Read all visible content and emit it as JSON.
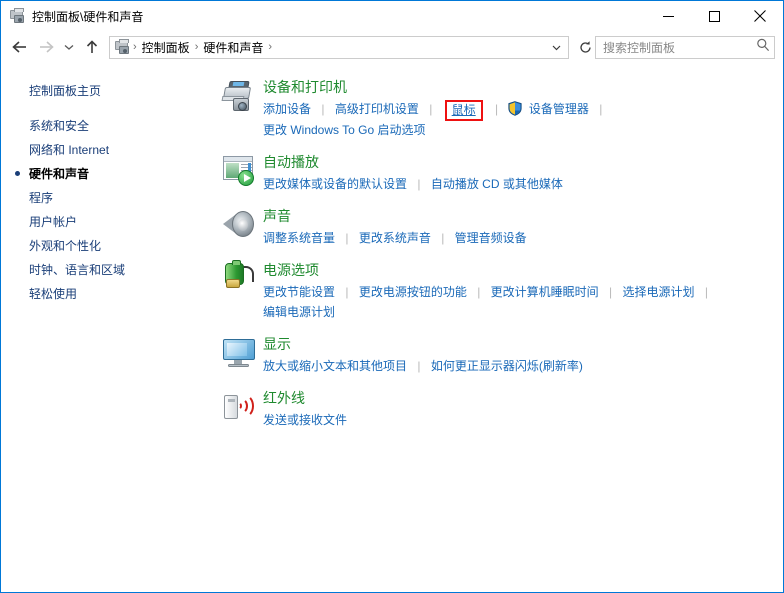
{
  "window": {
    "title": "控制面板\\硬件和声音",
    "icon": "control-panel-devices-icon",
    "minimize_label": "最小化",
    "maximize_label": "最大化",
    "close_label": "关闭"
  },
  "toolbar": {
    "back_label": "后退",
    "forward_label": "前进",
    "recent_label": "最近浏览的位置",
    "up_label": "向上",
    "address": {
      "crumbs": [
        "控制面板",
        "硬件和声音"
      ],
      "separator": "›",
      "dropdown_label": "展开",
      "refresh_label": "刷新"
    },
    "search": {
      "placeholder": "搜索控制面板",
      "icon": "search-icon"
    }
  },
  "sidebar": {
    "items": [
      {
        "label": "控制面板主页",
        "active": false
      },
      {
        "label": "系统和安全",
        "active": false
      },
      {
        "label": "网络和 Internet",
        "active": false
      },
      {
        "label": "硬件和声音",
        "active": true
      },
      {
        "label": "程序",
        "active": false
      },
      {
        "label": "用户帐户",
        "active": false
      },
      {
        "label": "外观和个性化",
        "active": false
      },
      {
        "label": "时钟、语言和区域",
        "active": false
      },
      {
        "label": "轻松使用",
        "active": false
      }
    ]
  },
  "categories": [
    {
      "icon": "printer-icon",
      "title": "设备和打印机",
      "links": [
        "添加设备",
        "高级打印机设置",
        "鼠标",
        "设备管理器",
        "更改 Windows To Go 启动选项"
      ]
    },
    {
      "icon": "autoplay-icon",
      "title": "自动播放",
      "links": [
        "更改媒体或设备的默认设置",
        "自动播放 CD 或其他媒体"
      ]
    },
    {
      "icon": "speaker-icon",
      "title": "声音",
      "links": [
        "调整系统音量",
        "更改系统声音",
        "管理音频设备"
      ]
    },
    {
      "icon": "battery-icon",
      "title": "电源选项",
      "links": [
        "更改节能设置",
        "更改电源按钮的功能",
        "更改计算机睡眠时间",
        "选择电源计划",
        "编辑电源计划"
      ]
    },
    {
      "icon": "monitor-icon",
      "title": "显示",
      "links": [
        "放大或缩小文本和其他项目",
        "如何更正显示器闪烁(刷新率)"
      ]
    },
    {
      "icon": "infrared-icon",
      "title": "红外线",
      "links": [
        "发送或接收文件"
      ]
    }
  ],
  "annotations": {
    "highlighted_link": "鼠标",
    "highlight_color": "#ee1111"
  },
  "colors": {
    "category_title": "#1f8a2f",
    "link": "#1a69b8",
    "sidebar_link": "#1a3e78",
    "window_border": "#0078d7"
  }
}
